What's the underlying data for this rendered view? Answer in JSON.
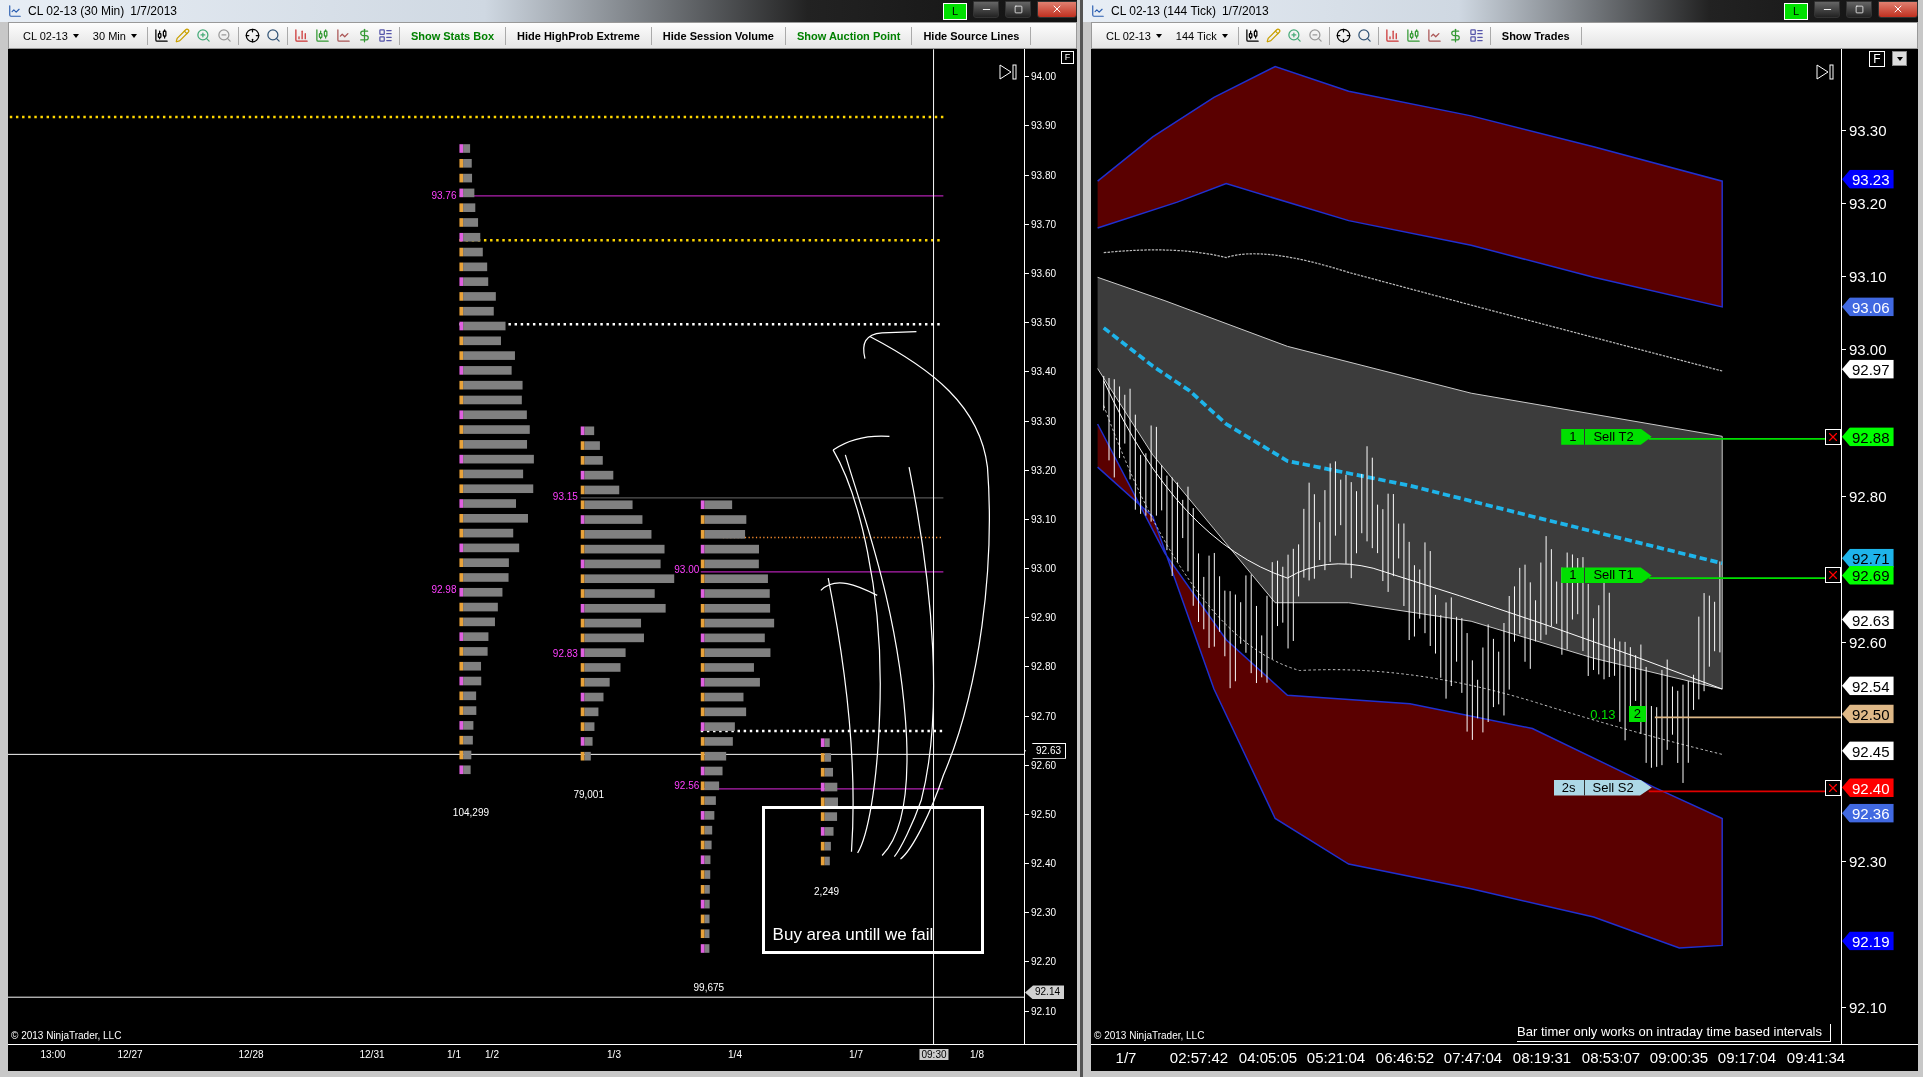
{
  "left_window": {
    "title": "CL 02-13 (30 Min)",
    "date": "1/7/2013",
    "connection": "L",
    "toolbar": {
      "instrument": "CL 02-13",
      "interval": "30 Min",
      "buttons": [
        {
          "label": "Show Stats Box",
          "color": "#008000"
        },
        {
          "label": "Hide HighProb Extreme",
          "color": "#000000"
        },
        {
          "label": "Hide Session Volume",
          "color": "#000000"
        },
        {
          "label": "Show Auction Point",
          "color": "#008000"
        },
        {
          "label": "Hide Source Lines",
          "color": "#000000"
        }
      ]
    },
    "chart": {
      "labels": [
        "93.76",
        "92.98",
        "104,299",
        "93.15",
        "92.83",
        "79,001",
        "93.00",
        "92.56",
        "99,675",
        "2,249"
      ],
      "note": "Buy area untill we fail",
      "copyright": "© 2013 NinjaTrader, LLC",
      "scale_button": "F"
    },
    "price_axis": {
      "ticks": [
        "94.00",
        "93.90",
        "93.80",
        "93.70",
        "93.60",
        "93.50",
        "93.40",
        "93.30",
        "93.20",
        "93.10",
        "93.00",
        "92.90",
        "92.80",
        "92.70",
        "92.60",
        "92.50",
        "92.40",
        "92.30",
        "92.20",
        "92.10"
      ],
      "tags": [
        {
          "value": "92.63",
          "kind": "outlined"
        },
        {
          "value": "92.14",
          "kind": "filled"
        }
      ]
    },
    "time_axis": [
      {
        "label": "13:00",
        "selected": false
      },
      {
        "label": "12/27",
        "selected": false
      },
      {
        "label": "12/28",
        "selected": false
      },
      {
        "label": "12/31",
        "selected": false
      },
      {
        "label": "1/1",
        "selected": false
      },
      {
        "label": "1/2",
        "selected": false
      },
      {
        "label": "1/3",
        "selected": false
      },
      {
        "label": "1/4",
        "selected": false
      },
      {
        "label": "1/7",
        "selected": false
      },
      {
        "label": "09:30",
        "selected": true
      },
      {
        "label": "1/8",
        "selected": false
      }
    ]
  },
  "right_window": {
    "title": "CL 02-13 (144 Tick)",
    "date": "1/7/2013",
    "connection": "L",
    "toolbar": {
      "instrument": "CL 02-13",
      "interval": "144 Tick",
      "buttons": [
        {
          "label": "Show Trades",
          "color": "#000000"
        }
      ]
    },
    "chart": {
      "copyright": "© 2013 NinjaTrader, LLC",
      "bar_timer": "Bar timer only works on intraday time based intervals",
      "scale_button": "F",
      "orders": [
        {
          "quantity": "1",
          "label": "Sell T2",
          "kind": "target"
        },
        {
          "quantity": "1",
          "label": "Sell T1",
          "kind": "target"
        },
        {
          "quantity": "2s",
          "label": "Sell S2",
          "kind": "stop"
        }
      ],
      "position": {
        "pnl": "0.13",
        "quantity": "2"
      }
    },
    "price_axis": {
      "ticks": [
        "93.30",
        "93.20",
        "93.10",
        "93.00",
        "92.80",
        "92.60",
        "92.30",
        "92.10"
      ],
      "tags": [
        {
          "value": "93.23",
          "color": "#0000ff"
        },
        {
          "value": "93.06",
          "color": "#4169e1"
        },
        {
          "value": "92.97",
          "color": "#ffffff"
        },
        {
          "value": "92.88",
          "color": "#00ff00"
        },
        {
          "value": "92.71",
          "color": "#1eb4ea"
        },
        {
          "value": "92.69",
          "color": "#00ff00"
        },
        {
          "value": "92.63",
          "color": "#ffffff"
        },
        {
          "value": "92.54",
          "color": "#ffffff"
        },
        {
          "value": "92.50",
          "color": "#deb887"
        },
        {
          "value": "92.45",
          "color": "#ffffff"
        },
        {
          "value": "92.40",
          "color": "#ff0000"
        },
        {
          "value": "92.36",
          "color": "#4169e1"
        },
        {
          "value": "92.19",
          "color": "#0000ff"
        }
      ]
    },
    "time_axis": [
      {
        "label": "1/7",
        "selected": false
      },
      {
        "label": "02:57:42",
        "selected": false
      },
      {
        "label": "04:05:05",
        "selected": false
      },
      {
        "label": "05:21:04",
        "selected": false
      },
      {
        "label": "06:46:52",
        "selected": false
      },
      {
        "label": "07:47:04",
        "selected": false
      },
      {
        "label": "08:19:31",
        "selected": false
      },
      {
        "label": "08:53:07",
        "selected": false
      },
      {
        "label": "09:00:35",
        "selected": false
      },
      {
        "label": "09:17:04",
        "selected": false
      },
      {
        "label": "09:41:34",
        "selected": false
      }
    ]
  }
}
